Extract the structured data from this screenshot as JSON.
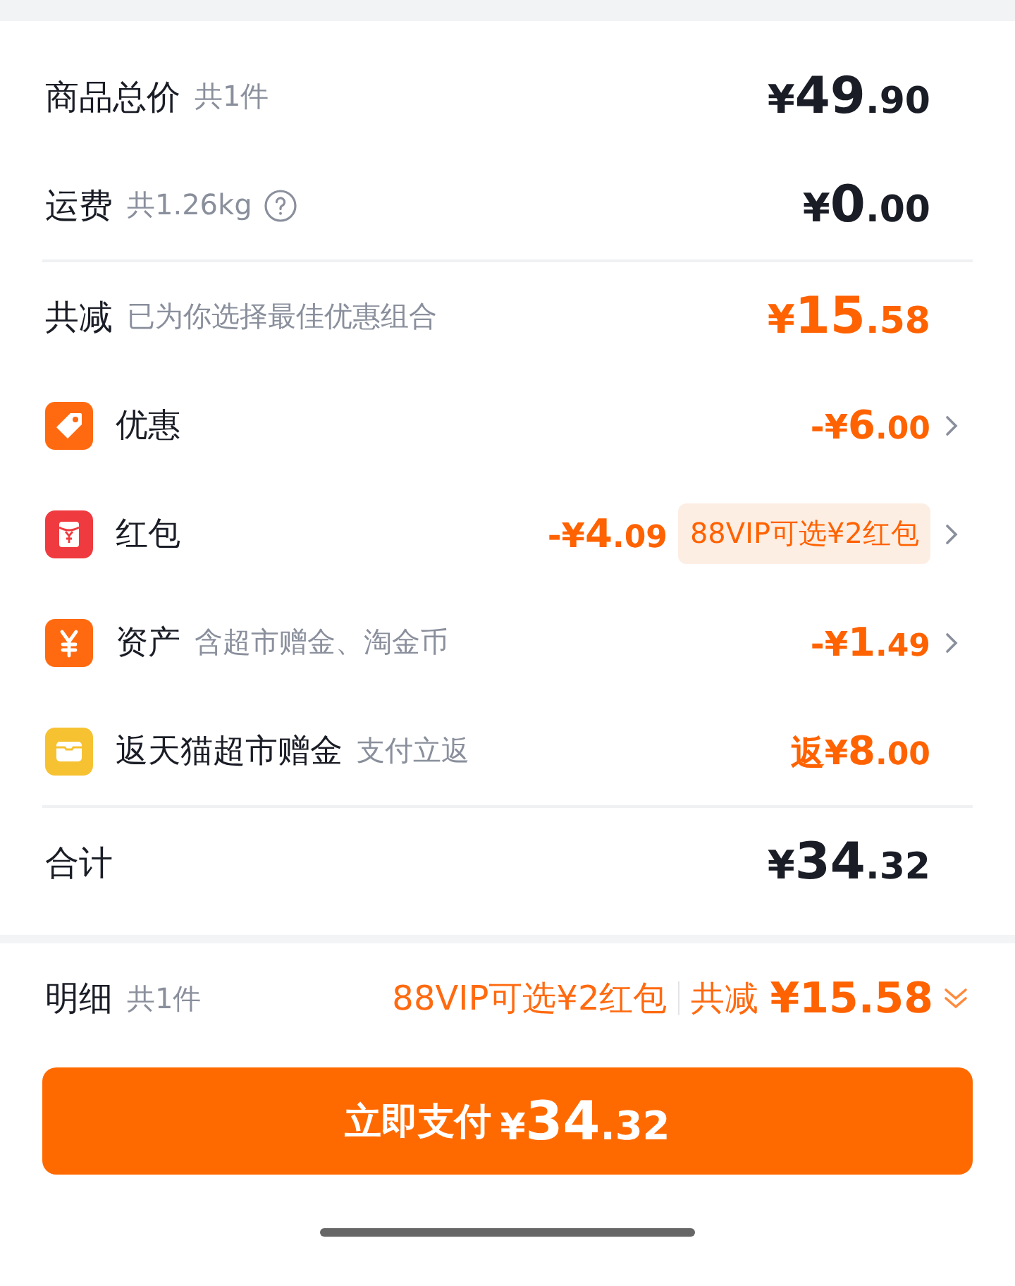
{
  "summary": [
    {
      "label": "商品总价",
      "note": "共1件",
      "help": false,
      "amount": "¥49.90"
    },
    {
      "label": "运费",
      "note": "共1.26kg",
      "help": true,
      "amount": "¥0.00"
    }
  ],
  "discount": {
    "label": "共减",
    "note": "已为你选择最佳优惠组合",
    "amount": "¥15.58"
  },
  "items": [
    {
      "kind": "tag",
      "label": "优惠",
      "amount": "-¥6.00",
      "chevron": true
    },
    {
      "kind": "red-packet",
      "label": "红包",
      "amount": "-¥4.09",
      "badge": "88VIP可选¥2红包",
      "chevron": true
    },
    {
      "kind": "yen",
      "label": "资产",
      "note": "含超市赠金、淘金币",
      "amount": "-¥1.49",
      "chevron": true
    },
    {
      "kind": "card",
      "label": "返天猫超市赠金",
      "note": "支付立返",
      "amount": "返¥8.00",
      "chevron": false
    }
  ],
  "total": {
    "label": "合计",
    "amount": "¥34.32"
  },
  "footer": {
    "label": "明细",
    "note": "共1件",
    "promo": "88VIP可选¥2红包",
    "discount_label": "共减",
    "discount_amount": "¥15.58"
  },
  "pay_button": {
    "label": "立即支付",
    "amount": "¥34.32"
  }
}
